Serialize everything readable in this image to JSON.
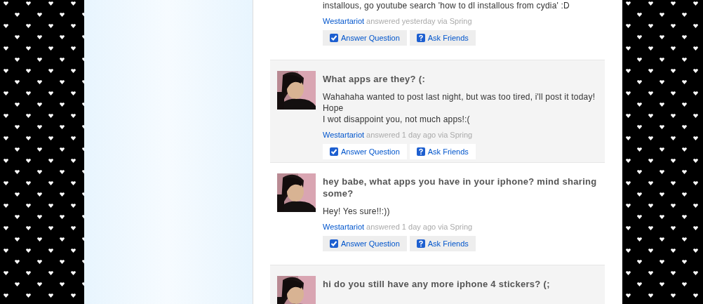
{
  "answers": [
    {
      "answer": "installous, go youtube search 'how to dl installous from cydia' :D",
      "author": "Westartariot",
      "meta": "answered yesterday via Spring",
      "actions": [
        "Answer Question",
        "Ask Friends"
      ]
    },
    {
      "question": "What apps are they? (:",
      "answer": "Wahahaha wanted to post last night, but was too tired, i'll post it today! Hope\nI wot disappoint you, not much apps!:(",
      "author": "Westartariot",
      "meta": "answered 1 day ago via Spring",
      "actions": [
        "Answer Question",
        "Ask Friends"
      ]
    },
    {
      "question": "hey babe, what apps you have in your iphone? mind sharing some?",
      "answer": "Hey! Yes sure!!:))",
      "author": "Westartariot",
      "meta": "answered 1 day ago via Spring",
      "actions": [
        "Answer Question",
        "Ask Friends"
      ]
    },
    {
      "question": "hi do you still have any more iphone 4 stickers? (;"
    }
  ]
}
